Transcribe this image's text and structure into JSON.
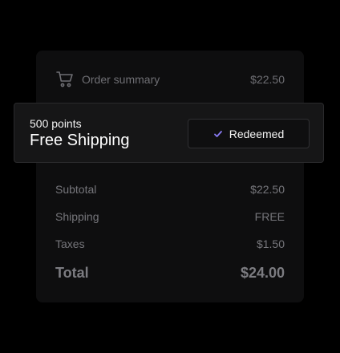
{
  "order_summary": {
    "label": "Order summary",
    "price": "$22.50",
    "icon": "cart-icon"
  },
  "reward": {
    "points": "500 points",
    "title": "Free Shipping",
    "button_label": "Redeemed",
    "button_icon": "check-icon",
    "accent_color": "#8b7cf6"
  },
  "lines": [
    {
      "label": "Subtotal",
      "value": "$22.50"
    },
    {
      "label": "Shipping",
      "value": "FREE"
    },
    {
      "label": "Taxes",
      "value": "$1.50"
    }
  ],
  "total": {
    "label": "Total",
    "value": "$24.00"
  }
}
